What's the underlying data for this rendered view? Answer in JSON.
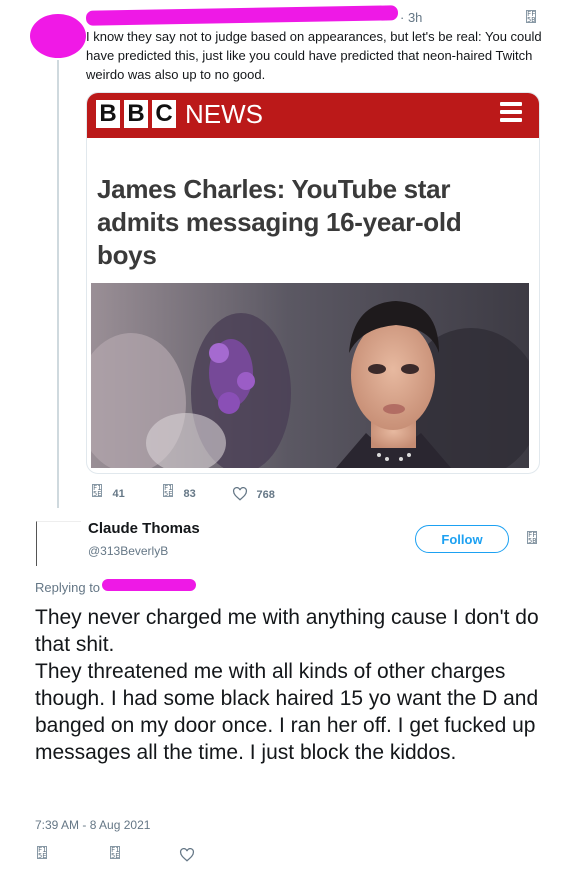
{
  "top_tweet": {
    "time": "3h",
    "text": "I know they say not to judge based on appearances, but let's be real: You could have predicted this, just like you could have predicted that neon-haired Twitch weirdo was also up to no good.",
    "card": {
      "brand_letters": [
        "B",
        "B",
        "C"
      ],
      "brand_word": "NEWS",
      "headline": "James Charles: YouTube star admits messaging 16-year-old boys"
    },
    "actions": {
      "replies": "41",
      "retweets": "83",
      "likes": "768"
    }
  },
  "reply_tweet": {
    "display_name": "Claude Thomas",
    "handle": "@313BeverlyB",
    "follow_label": "Follow",
    "replying_to_label": "Replying to",
    "text": "They never charged me with anything cause I don't do that shit.\nThey threatened me with all kinds of other charges though. I had some black haired 15 yo want the D and banged on my door once. I ran her off. I get fucked up messages all the time. I just block the kiddos.",
    "timestamp": "7:39 AM - 8 Aug 2021"
  },
  "colors": {
    "redaction": "#ee19e6",
    "bbc_red": "#bb1919",
    "twitter_blue": "#1da1f2",
    "muted_text": "#657786"
  },
  "icons": [
    "caret-icon",
    "reply-icon",
    "retweet-icon",
    "heart-icon"
  ]
}
